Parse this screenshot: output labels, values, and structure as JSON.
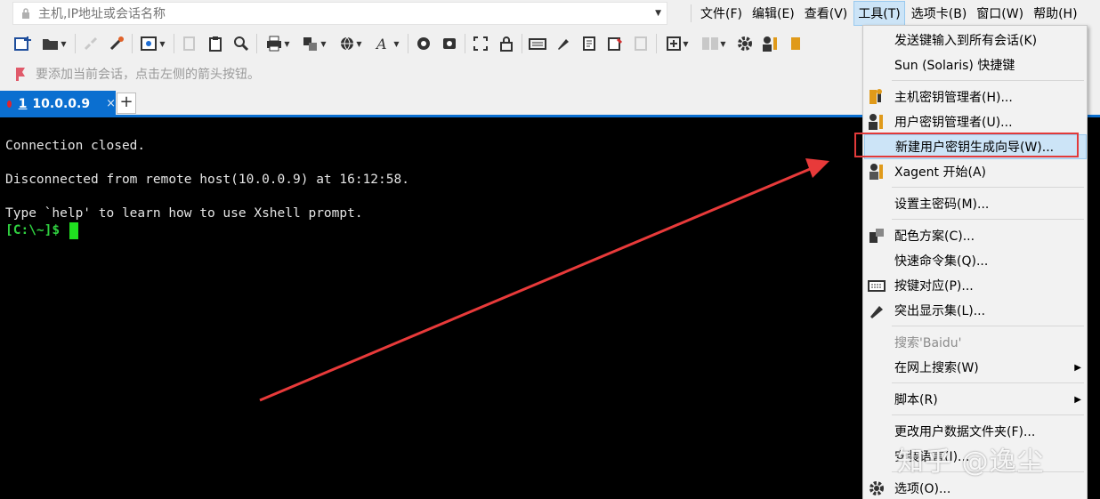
{
  "address_bar": {
    "placeholder": "主机,IP地址或会话名称"
  },
  "menubar": {
    "items": [
      "文件(F)",
      "编辑(E)",
      "查看(V)",
      "工具(T)",
      "选项卡(B)",
      "窗口(W)",
      "帮助(H)"
    ],
    "active": "工具(T)"
  },
  "hint": {
    "text": "要添加当前会话，点击左侧的箭头按钮。"
  },
  "tabs": [
    {
      "number": "1",
      "host": "10.0.0.9",
      "close": "×"
    }
  ],
  "add_tab": "+",
  "terminal": {
    "lines": [
      "Connection closed.",
      "Disconnected from remote host(10.0.0.9) at 16:12:58.",
      "Type `help' to learn how to use Xshell prompt."
    ],
    "prompt": "[C:\\~]$"
  },
  "tools_menu": {
    "items": [
      {
        "label": "发送键输入到所有会话(K)",
        "icon": ""
      },
      {
        "label": "Sun (Solaris) 快捷键",
        "icon": ""
      },
      {
        "label": "主机密钥管理者(H)...",
        "icon": "host-key-icon"
      },
      {
        "label": "用户密钥管理者(U)...",
        "icon": "user-key-icon"
      },
      {
        "label": "新建用户密钥生成向导(W)...",
        "icon": "",
        "highlighted": true
      },
      {
        "label": "Xagent 开始(A)",
        "icon": "xagent-icon"
      },
      {
        "label": "设置主密码(M)...",
        "icon": ""
      },
      {
        "label": "配色方案(C)...",
        "icon": "color-scheme-icon"
      },
      {
        "label": "快速命令集(Q)...",
        "icon": ""
      },
      {
        "label": "按键对应(P)...",
        "icon": "keyboard-icon"
      },
      {
        "label": "突出显示集(L)...",
        "icon": "highlighter-icon"
      },
      {
        "label": "搜索'Baidu'",
        "icon": "",
        "disabled": true
      },
      {
        "label": "在网上搜索(W)",
        "icon": "",
        "submenu": true
      },
      {
        "label": "脚本(R)",
        "icon": "",
        "submenu": true
      },
      {
        "label": "更改用户数据文件夹(F)...",
        "icon": ""
      },
      {
        "label": "安装语言(I)...",
        "icon": ""
      },
      {
        "label": "选项(O)...",
        "icon": "gear-icon"
      }
    ]
  },
  "watermark": "知乎 @逸尘",
  "colors": {
    "tab_blue": "#0b6fd0",
    "highlight_red": "#e23a3a",
    "prompt_green": "#30d040"
  }
}
